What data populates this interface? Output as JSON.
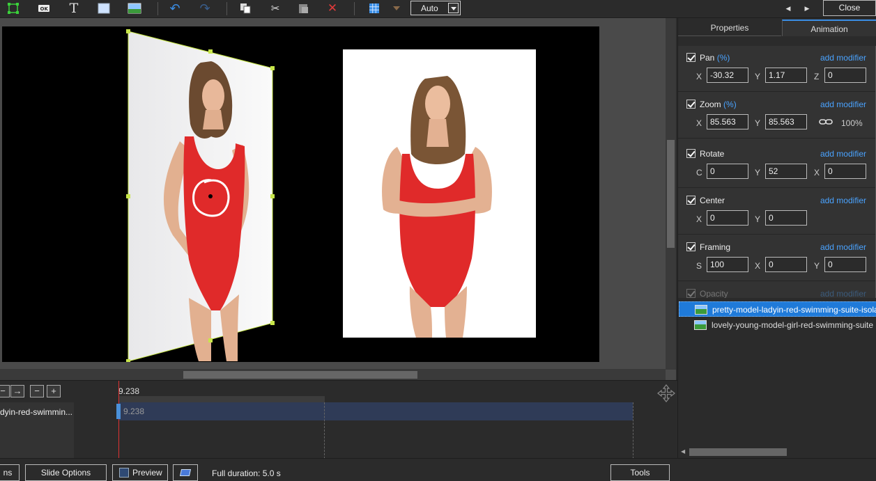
{
  "toolbar": {
    "icons": [
      "frame-icon",
      "ok-button-icon",
      "text-icon",
      "rectangle-icon",
      "image-icon",
      "undo-icon",
      "redo-icon",
      "copy-icon",
      "cut-icon",
      "paste-icon",
      "delete-icon",
      "grid-icon",
      "arrow-down-icon"
    ],
    "auto_label": "Auto",
    "close_label": "Close"
  },
  "tabs": {
    "properties": "Properties",
    "animation": "Animation"
  },
  "animation": {
    "add_modifier": "add modifier",
    "pan": {
      "title": "Pan",
      "unit": "(%)",
      "x_label": "X",
      "x": "-30.32",
      "y_label": "Y",
      "y": "1.17",
      "z_label": "Z",
      "z": "0"
    },
    "zoom": {
      "title": "Zoom",
      "unit": "(%)",
      "x_label": "X",
      "x": "85.563",
      "y_label": "Y",
      "y": "85.563",
      "percent": "100%"
    },
    "rotate": {
      "title": "Rotate",
      "c_label": "C",
      "c": "0",
      "y_label": "Y",
      "y": "52",
      "x_label": "X",
      "x": "0"
    },
    "center": {
      "title": "Center",
      "x_label": "X",
      "x": "0",
      "y_label": "Y",
      "y": "0"
    },
    "framing": {
      "title": "Framing",
      "s_label": "S",
      "s": "100",
      "x_label": "X",
      "x": "0",
      "y_label": "Y",
      "y": "0"
    },
    "opacity": {
      "title": "Opacity"
    }
  },
  "files": [
    {
      "name": "pretty-model-ladyin-red-swimming-suite-isolated"
    },
    {
      "name": "lovely-young-model-girl-red-swimming-suite"
    }
  ],
  "timeline": {
    "ruler_time": "9.238",
    "track_name": "dyin-red-swimmin...",
    "clip_time": "9.238"
  },
  "bottom": {
    "ns_label": "ns",
    "slide_options": "Slide Options",
    "preview": "Preview",
    "full_duration": "Full duration: 5.0 s",
    "tools": "Tools"
  },
  "colors": {
    "accent": "#3a8ee6",
    "selection": "#1f7ad9",
    "link": "#4aa3ff",
    "outline": "#c8e64a",
    "swimsuit": "#e02a2a"
  }
}
